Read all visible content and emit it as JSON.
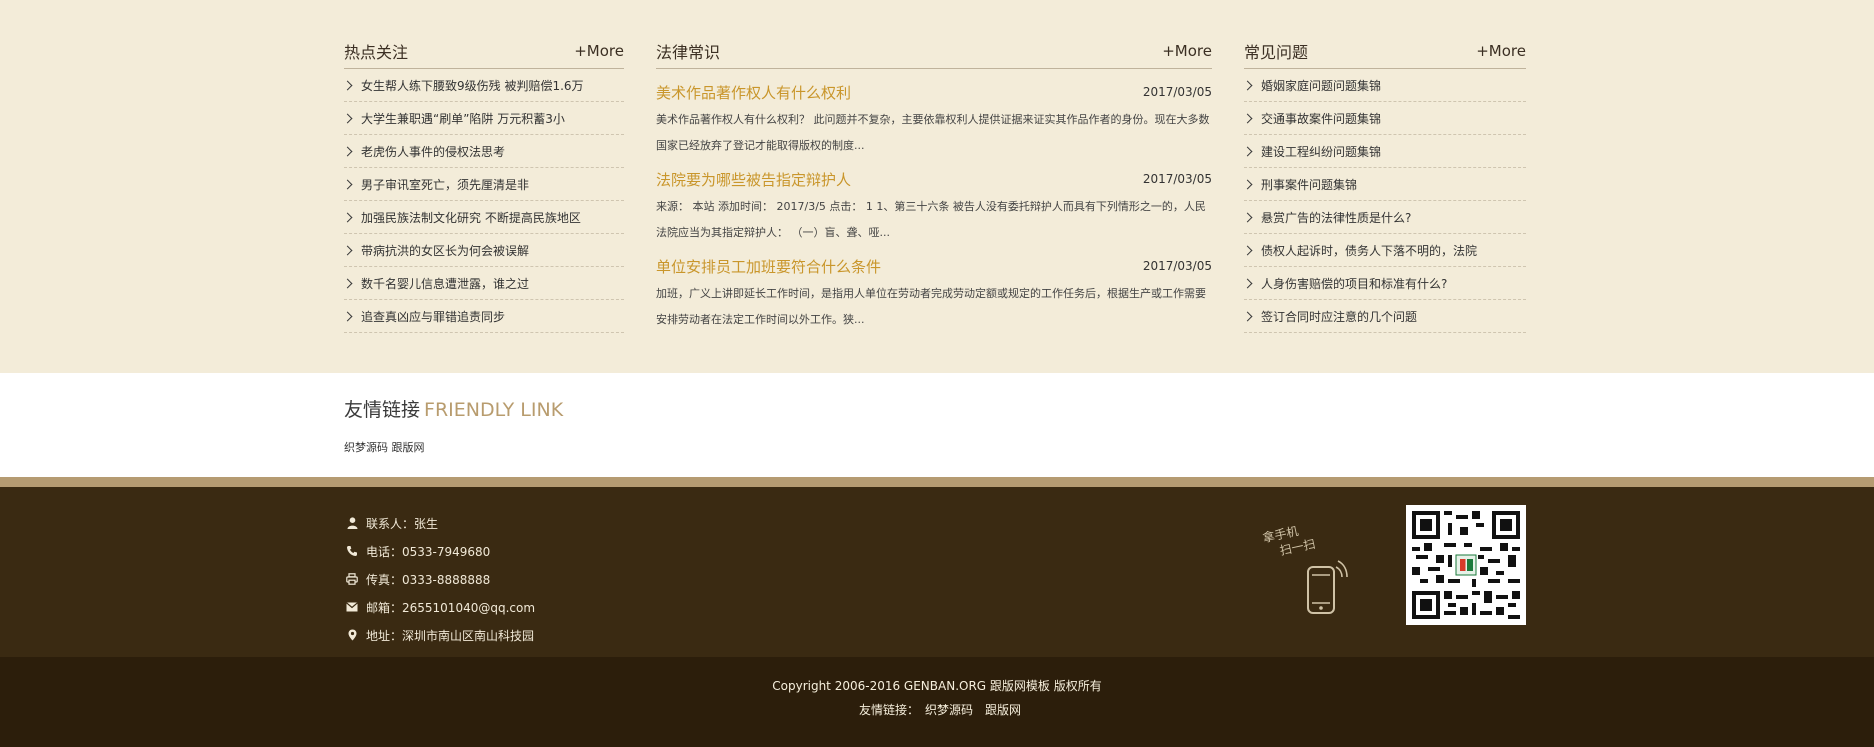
{
  "hot": {
    "title": "热点关注",
    "more": "+More",
    "items": [
      "女生帮人练下腰致9级伤残 被判赔偿1.6万",
      "大学生兼职遇“刷单”陷阱 万元积蓄3小",
      "老虎伤人事件的侵权法思考",
      "男子审讯室死亡，须先厘清是非",
      "加强民族法制文化研究 不断提高民族地区",
      "带病抗洪的女区长为何会被误解",
      "数千名婴儿信息遭泄露，谁之过",
      "追查真凶应与罪错追责同步"
    ]
  },
  "law": {
    "title": "法律常识",
    "more": "+More",
    "articles": [
      {
        "title": "美术作品著作权人有什么权利",
        "date": "2017/03/05",
        "desc": "美术作品著作权人有什么权利？ 此问题并不复杂，主要依靠权利人提供证据来证实其作品作者的身份。现在大多数国家已经放弃了登记才能取得版权的制度..."
      },
      {
        "title": "法院要为哪些被告指定辩护人",
        "date": "2017/03/05",
        "desc": "来源： 本站 添加时间： 2017/3/5 点击： 1 1、第三十六条 被告人没有委托辩护人而具有下列情形之一的，人民法院应当为其指定辩护人： （一）盲、聋、哑..."
      },
      {
        "title": "单位安排员工加班要符合什么条件",
        "date": "2017/03/05",
        "desc": "加班，广义上讲即延长工作时间，是指用人单位在劳动者完成劳动定额或规定的工作任务后，根据生产或工作需要安排劳动者在法定工作时间以外工作。狭..."
      }
    ]
  },
  "faq": {
    "title": "常见问题",
    "more": "+More",
    "items": [
      "婚姻家庭问题问题集锦",
      "交通事故案件问题集锦",
      "建设工程纠纷问题集锦",
      "刑事案件问题集锦",
      "悬赏广告的法律性质是什么?",
      "债权人起诉时，债务人下落不明的，法院",
      "人身伤害赔偿的项目和标准有什么?",
      "签订合同时应注意的几个问题"
    ]
  },
  "links": {
    "title_cn": "友情链接",
    "title_en": "FRIENDLY LINK",
    "items": [
      "织梦源码",
      "跟版网"
    ]
  },
  "contact": {
    "items": [
      {
        "icon": "user-icon",
        "text": "联系人：张生"
      },
      {
        "icon": "phone-icon",
        "text": "电话：0533-7949680"
      },
      {
        "icon": "printer-icon",
        "text": "传真：0333-8888888"
      },
      {
        "icon": "envelope-icon",
        "text": "邮箱：2655101040@qq.com"
      },
      {
        "icon": "map-marker-icon",
        "text": "地址：深圳市南山区南山科技园"
      }
    ],
    "scan_line1": "拿手机",
    "scan_line2": "扫一扫"
  },
  "footer": {
    "copyright": "Copyright 2006-2016 GENBAN.ORG 跟版网模板 版权所有",
    "links_label": "友情链接：",
    "links": [
      "织梦源码",
      "跟版网"
    ]
  },
  "colors": {
    "accent_gold": "#c9962b",
    "band_beige": "#f3ecd9",
    "footer_brown": "#3a2a12",
    "copyright_brown": "#2c1e0b"
  }
}
